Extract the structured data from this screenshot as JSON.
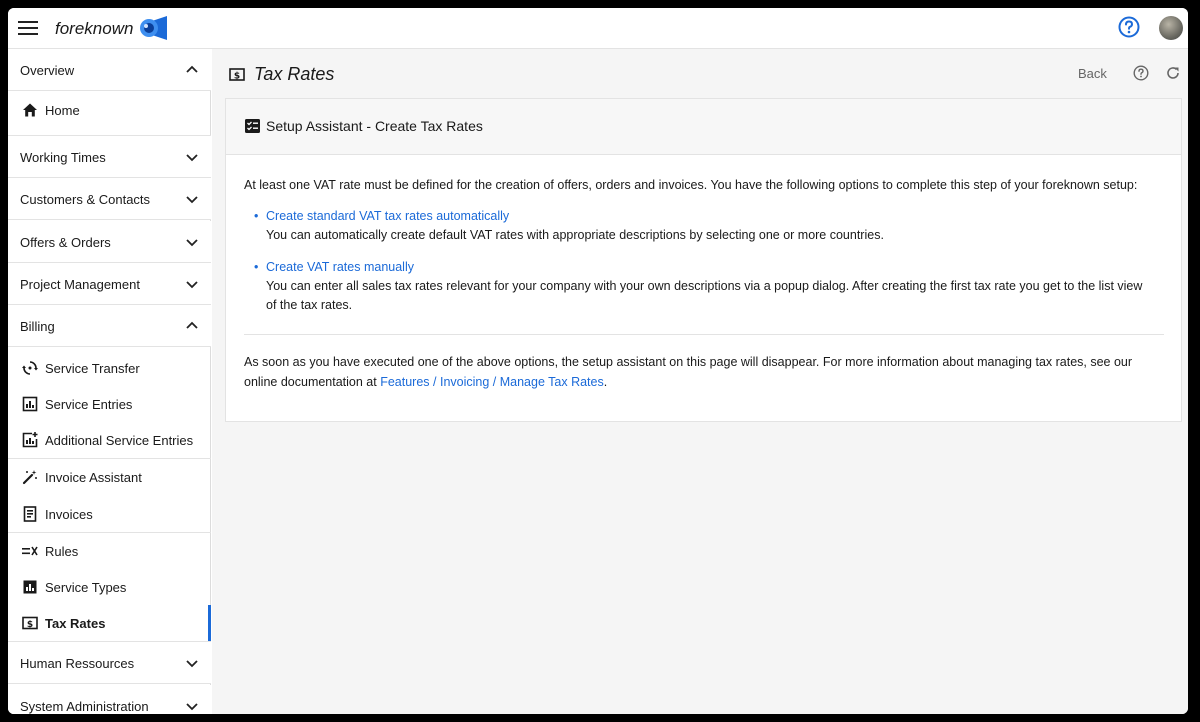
{
  "app": {
    "brand": "foreknown",
    "icons": {
      "menu": "hamburger-icon",
      "help": "help-circle-icon",
      "avatar": "user-avatar"
    },
    "accent": "#1b6ad8"
  },
  "sidebar": {
    "overview": "Overview",
    "home": "Home",
    "working_times": "Working Times",
    "customers": "Customers & Contacts",
    "offers": "Offers & Orders",
    "project": "Project Management",
    "billing": "Billing",
    "billing_items": {
      "service_transfer": "Service Transfer",
      "service_entries": "Service Entries",
      "additional_entries": "Additional Service Entries",
      "invoice_assistant": "Invoice Assistant",
      "invoices": "Invoices",
      "rules": "Rules",
      "service_types": "Service Types",
      "tax_rates": "Tax Rates"
    },
    "human_resources": "Human Ressources",
    "system_admin": "System Administration"
  },
  "page": {
    "title": "Tax Rates",
    "back_label": "Back"
  },
  "card": {
    "title": "Setup Assistant - Create Tax Rates",
    "intro": "At least one VAT rate must be defined for the creation of offers, orders and invoices. You have the following options to complete this step of your foreknown setup:",
    "option1_link": "Create standard VAT tax rates automatically",
    "option1_desc": "You can automatically create default VAT rates with appropriate descriptions by selecting one or more countries.",
    "option2_link": "Create VAT rates manually",
    "option2_desc": "You can enter all sales tax rates relevant for your company with your own descriptions via a popup dialog. After creating the first tax rate you get to the list view of the tax rates.",
    "footer_text": "As soon as you have executed one of the above options, the setup assistant on this page will disappear. For more information about managing tax rates, see our online documentation at",
    "footer_link": "Features / Invoicing / Manage Tax Rates",
    "footer_end": "."
  }
}
